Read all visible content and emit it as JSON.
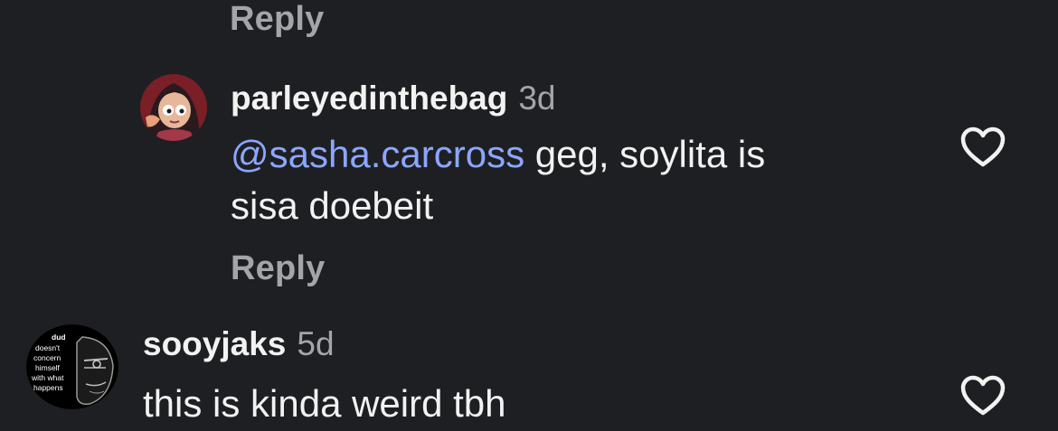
{
  "top_reply": {
    "label": "Reply"
  },
  "comments": [
    {
      "username": "parleyedinthebag",
      "time": "3d",
      "mention": "@sasha.carcross",
      "text_line1": " geg, soylita is",
      "text_line2": "sisa doebeit",
      "reply_label": "Reply",
      "avatar_icon": "cartoon-girl-avatar",
      "like_icon": "heart-outline-icon"
    },
    {
      "username": "sooyjaks",
      "time": "5d",
      "text": "this is kinda weird tbh",
      "avatar_text": [
        "dud",
        "doesn't",
        "concern",
        "himself",
        "with what",
        "happens"
      ],
      "avatar_icon": "wojak-face-avatar",
      "like_icon": "heart-outline-icon"
    }
  ],
  "colors": {
    "background": "#1e1f22",
    "text": "#f2f2f2",
    "muted": "#a3a5a8",
    "mention": "#8ca6ff"
  }
}
